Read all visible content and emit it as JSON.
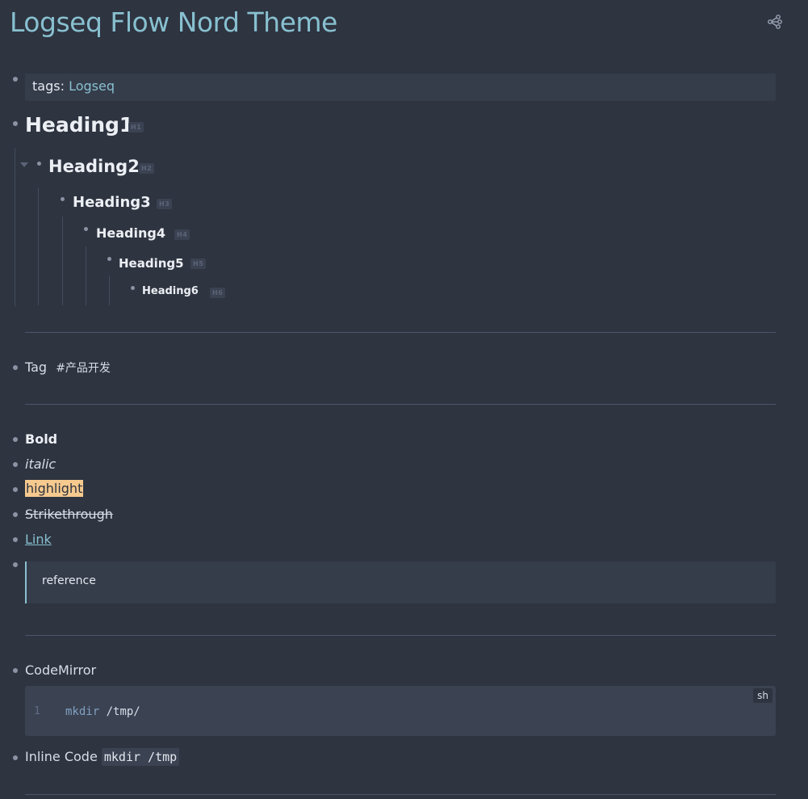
{
  "page": {
    "title": "Logseq Flow Nord Theme",
    "graph_icon": "graph-nodes-icon"
  },
  "tags": {
    "key": "tags:",
    "value": "Logseq"
  },
  "headings": [
    {
      "text": "Heading1",
      "badge": "H1"
    },
    {
      "text": "Heading2",
      "badge": "H2"
    },
    {
      "text": "Heading3",
      "badge": "H3"
    },
    {
      "text": "Heading4",
      "badge": "H4"
    },
    {
      "text": "Heading5",
      "badge": "H5"
    },
    {
      "text": "Heading6",
      "badge": "H6"
    }
  ],
  "tag_block": {
    "label": "Tag",
    "tag": "#产品开发"
  },
  "formatting": {
    "bold": "Bold",
    "italic": "italic",
    "highlight": "highlight",
    "strike": "Strikethrough",
    "link": "Link",
    "quote": "reference"
  },
  "code_block": {
    "label": "CodeMirror",
    "language": "sh",
    "line_number": "1",
    "keyword": "mkdir",
    "argument": "/tmp/"
  },
  "inline_code": {
    "label": "Inline Code",
    "code": "mkdir /tmp"
  },
  "colors": {
    "background": "#2e3440",
    "accent": "#88c0d0",
    "highlight": "#f6c98e",
    "block": "#353c4a"
  }
}
